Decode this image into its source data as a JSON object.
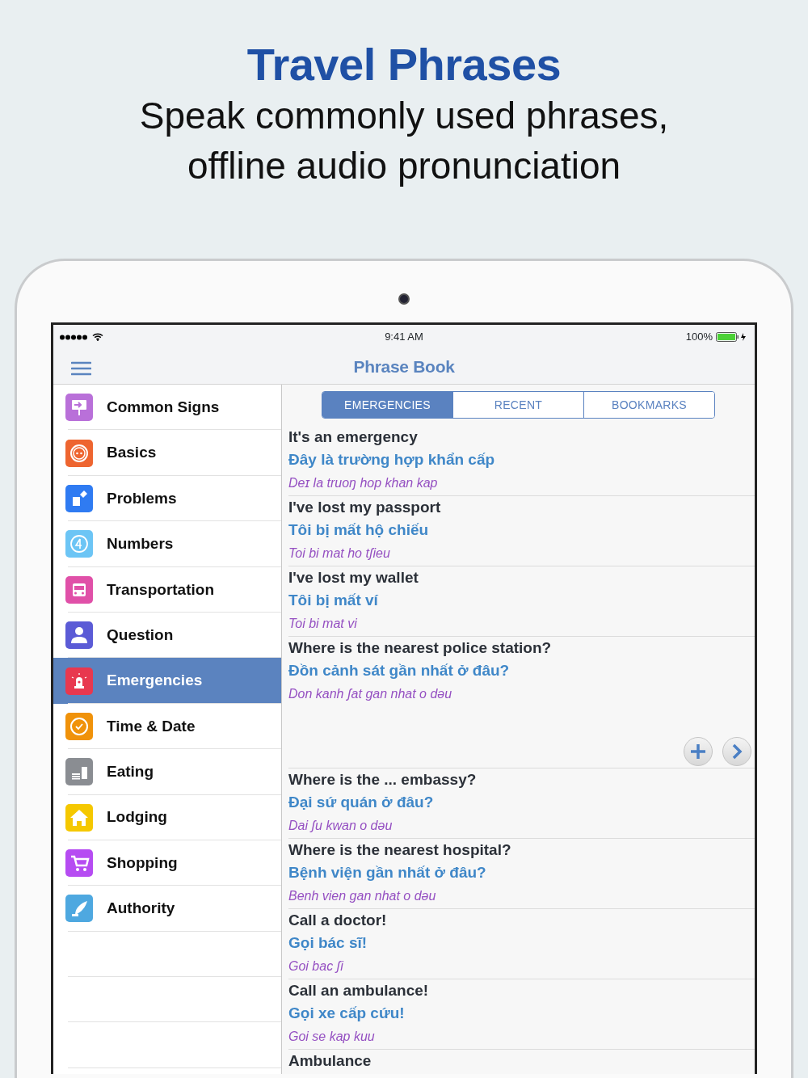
{
  "headline": {
    "title": "Travel Phrases",
    "subtitle": "Speak commonly used phrases, offline audio pronunciation"
  },
  "status_bar": {
    "time": "9:41 AM",
    "battery_text": "100%"
  },
  "nav_bar": {
    "title": "Phrase Book"
  },
  "sidebar": {
    "items": [
      {
        "label": "Common Signs",
        "color": "#b970d9",
        "selected": false
      },
      {
        "label": "Basics",
        "color": "#ee6530",
        "selected": false
      },
      {
        "label": "Problems",
        "color": "#2f7bf2",
        "selected": false
      },
      {
        "label": "Numbers",
        "color": "#6cc5f5",
        "selected": false
      },
      {
        "label": "Transportation",
        "color": "#e050a8",
        "selected": false
      },
      {
        "label": "Question",
        "color": "#5b5bd6",
        "selected": false
      },
      {
        "label": "Emergencies",
        "color": "#e8384f",
        "selected": true
      },
      {
        "label": "Time & Date",
        "color": "#f0920a",
        "selected": false
      },
      {
        "label": "Eating",
        "color": "#8a8d92",
        "selected": false
      },
      {
        "label": "Lodging",
        "color": "#f5c800",
        "selected": false
      },
      {
        "label": "Shopping",
        "color": "#b64cf2",
        "selected": false
      },
      {
        "label": "Authority",
        "color": "#4ea8e0",
        "selected": false
      }
    ]
  },
  "tabs": [
    {
      "label": "EMERGENCIES",
      "selected": true
    },
    {
      "label": "RECENT",
      "selected": false
    },
    {
      "label": "BOOKMARKS",
      "selected": false
    }
  ],
  "phrases": [
    {
      "english": "It's an emergency",
      "vietnamese": "Đây là trường hợp khẩn cấp",
      "pronunciation": "Deɪ la truoŋ hop khan kap",
      "expanded": false
    },
    {
      "english": "I've lost my passport",
      "vietnamese": "Tôi bị mất hộ chiếu",
      "pronunciation": "Toi bi mat ho tʃieu",
      "expanded": false
    },
    {
      "english": "I've lost my wallet",
      "vietnamese": "Tôi bị mất ví",
      "pronunciation": "Toi bi mat vi",
      "expanded": false
    },
    {
      "english": "Where is the nearest police station?",
      "vietnamese": "Đồn cảnh sát gần nhất ở đâu?",
      "pronunciation": "Don kanh ʃat gan nhat o dəu",
      "expanded": true
    },
    {
      "english": "Where is the ... embassy?",
      "vietnamese": "Đại sứ quán ở đâu?",
      "pronunciation": "Dai ʃu kwan o dəu",
      "expanded": false
    },
    {
      "english": "Where is the nearest hospital?",
      "vietnamese": "Bệnh viện gần nhất ở đâu?",
      "pronunciation": "Benh vien gan nhat o dəu",
      "expanded": false
    },
    {
      "english": "Call a doctor!",
      "vietnamese": "Gọi bác sĩ!",
      "pronunciation": "Goi bac ʃi",
      "expanded": false
    },
    {
      "english": "Call an ambulance!",
      "vietnamese": "Gọi xe cấp cứu!",
      "pronunciation": "Goi se kap kuu",
      "expanded": false
    },
    {
      "english": "Ambulance"
    }
  ]
}
